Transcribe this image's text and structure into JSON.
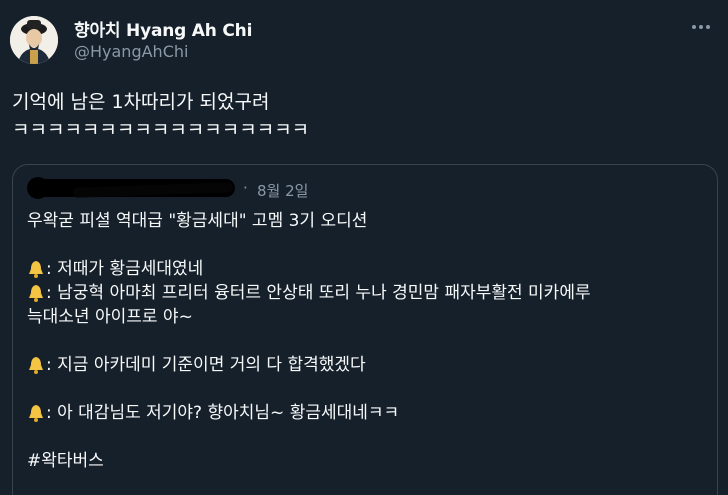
{
  "author": {
    "display_name": "향아치 Hyang Ah Chi",
    "handle": "@HyangAhChi"
  },
  "tweet": {
    "line1": "기억에 남은 1차따리가 되었구려",
    "line2": "ㅋㅋㅋㅋㅋㅋㅋㅋㅋㅋㅋㅋㅋㅋㅋㅋㅋ"
  },
  "quoted": {
    "separator": "·",
    "date": "8월 2일",
    "lines": {
      "l1": "우왁굳 피셜 역대급 \"황금세대\" 고멤 3기 오디션",
      "l3": ": 저때가 황금세대였네",
      "l4": ": 남궁혁 아마최 프리터 융터르 안상태 또리 누나 경민맘 패자부활전 미카에루",
      "l5": "늑대소년 아이프로 야~",
      "l7": ": 지금 아카데미 기준이면 거의 다 합격했겠다",
      "l9": ": 아 대감님도 저기야? 향아치님~ 황금세대네ㅋㅋ",
      "l11": "#왁타버스"
    }
  },
  "colors": {
    "background": "#15202b",
    "text": "#f7f9f9",
    "secondary": "#8b98a5",
    "border": "#38444d",
    "bell": "#f4c542"
  },
  "icons": {
    "more": "more-horizontal-icon",
    "bell": "bell-emoji-icon"
  }
}
